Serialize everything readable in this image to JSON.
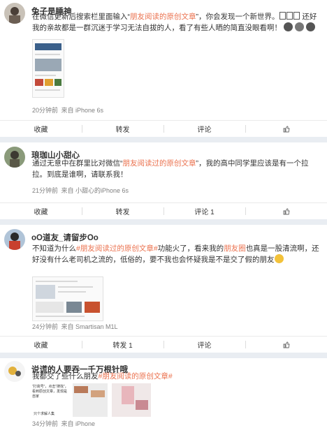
{
  "posts": [
    {
      "user": "兔子是睡神",
      "text_pre": "在微信更新后搜索栏里面输入“",
      "text_hl": "朋友阅读的原创文章",
      "text_mid": "”，你会发现一个新世界。",
      "text_post": " 还好我的亲故都是一群沉迷于学习无法自拔的人，看了有些人晒的简直没眼看啊！",
      "time": "20分钟前",
      "source": "来自 iPhone 6s",
      "actions": {
        "fav": "收藏",
        "repost": "转发",
        "comment": "评论",
        "like": ""
      }
    },
    {
      "user": "琅珈山小甜心",
      "text_pre": "通过无意中在群里比对微信“",
      "text_hl": "朋友阅读过的原创文章",
      "text_post": "”，我的高中同学里应该是有一个拉拉。到底是谁啊，请联系我！",
      "time": "21分钟前",
      "source": "来自 小甜心的iPhone 6s",
      "actions": {
        "fav": "收藏",
        "repost": "转发",
        "comment": "评论 1",
        "like": ""
      }
    },
    {
      "user": "oO道友_请留步Oo",
      "text_pre": "不知道为什么",
      "text_hl": "#朋友阅读过的原创文章#",
      "text_mid": "功能火了，看来我的",
      "text_hl2": "朋友圈",
      "text_post": "也真是一股清流啊，还好没有什么老司机之流的，低俗的，要不我也会怀疑我是不是交了假的朋友",
      "time": "24分钟前",
      "source": "来自 Smartisan M1L",
      "actions": {
        "fav": "收藏",
        "repost": "转发 1",
        "comment": "评论",
        "like": ""
      }
    },
    {
      "user": "说谎的人要吞一千万根针哦",
      "text_pre": "我都交了些什么朋友",
      "text_hl": "#朋友阅读的原创文章#",
      "time": "34分钟前",
      "source": "来自 iPhone",
      "img_text1": "“打高号”，点击“搜找”，看到原创文章，发现是自家",
      "img_text2": "只个求解人集"
    }
  ],
  "colors": {
    "accent": "#eb7350",
    "bg": "#e9edf2"
  }
}
